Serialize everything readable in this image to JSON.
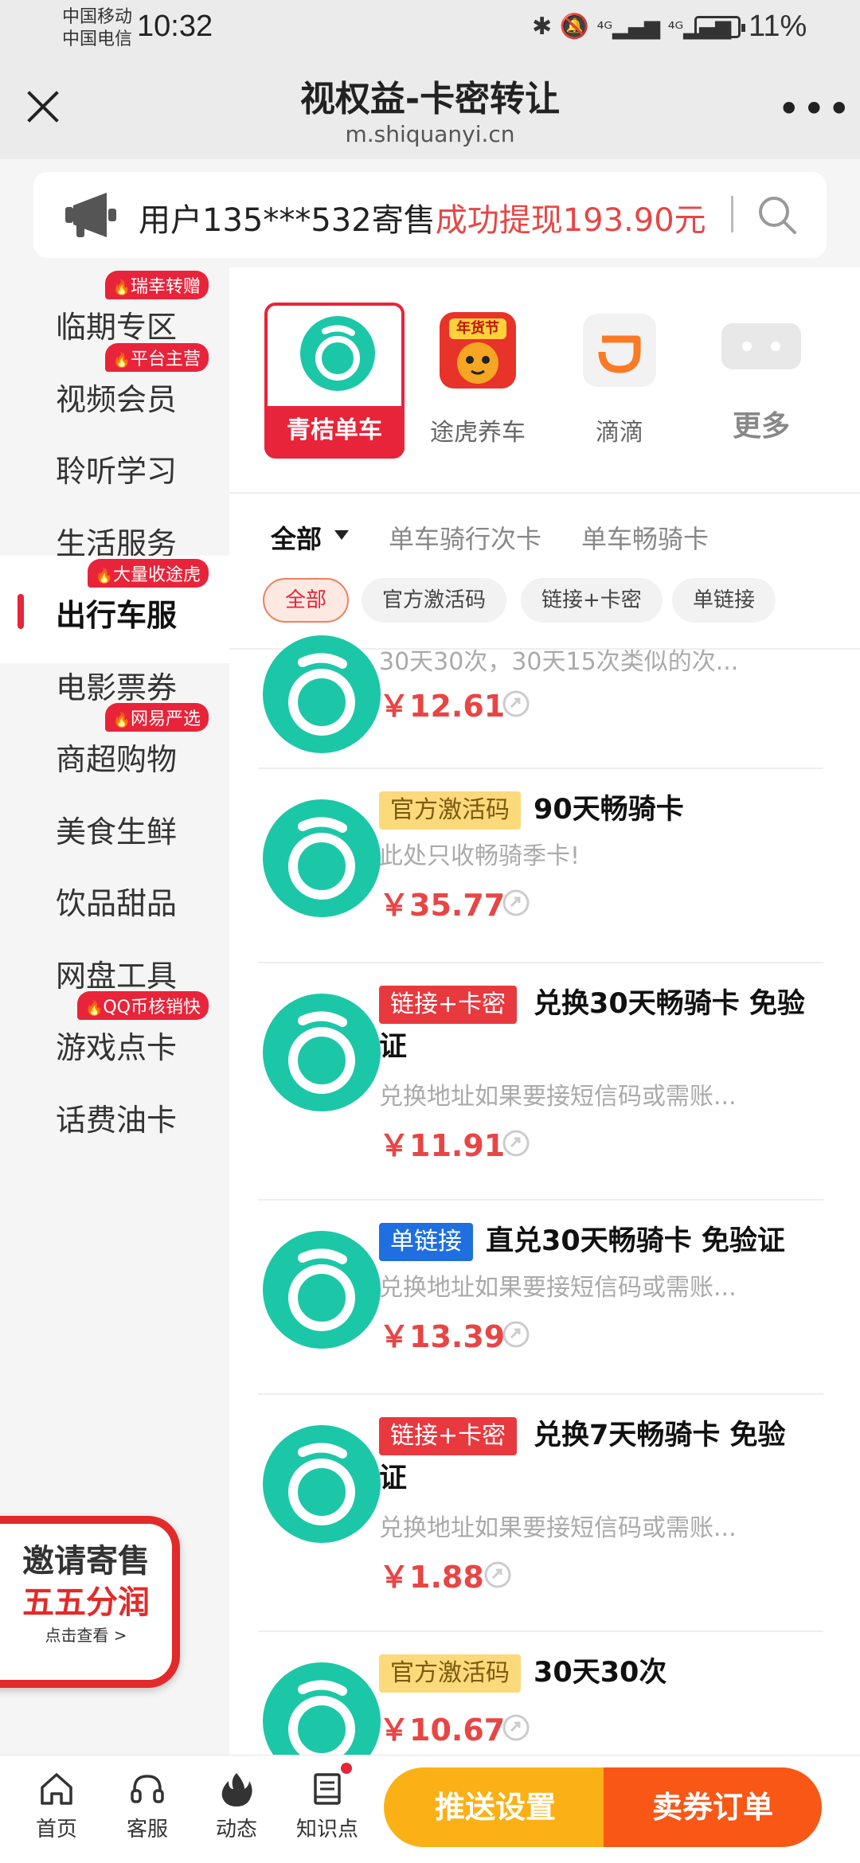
{
  "status_bar": {
    "carrier_1": "中国移动",
    "carrier_2": "中国电信",
    "time": "10:32",
    "signal_1": "⁴ᴳ",
    "signal_2": "⁴ᴳ",
    "battery": "11%"
  },
  "header": {
    "title": "视权益-卡密转让",
    "url": "m.shiquanyi.cn",
    "more_label": "•••"
  },
  "notice": {
    "prefix": "用户135***532寄售",
    "highlight": "成功提现193.90元"
  },
  "sidebar": {
    "items": [
      {
        "label": "临期专区",
        "tag": "瑞幸转赠"
      },
      {
        "label": "视频会员",
        "tag": "平台主营"
      },
      {
        "label": "聆听学习",
        "tag": ""
      },
      {
        "label": "生活服务",
        "tag": ""
      },
      {
        "label": "出行车服",
        "tag": "大量收途虎",
        "active": true
      },
      {
        "label": "电影票券",
        "tag": ""
      },
      {
        "label": "商超购物",
        "tag": "网易严选"
      },
      {
        "label": "美食生鲜",
        "tag": ""
      },
      {
        "label": "饮品甜品",
        "tag": ""
      },
      {
        "label": "网盘工具",
        "tag": ""
      },
      {
        "label": "游戏点卡",
        "tag": "QQ币核销快"
      },
      {
        "label": "话费油卡",
        "tag": ""
      }
    ]
  },
  "invite": {
    "line1": "邀请寄售",
    "line2": "五五分润",
    "line3": "点击查看 >"
  },
  "brands": [
    {
      "name": "青桔单车",
      "active": true
    },
    {
      "name": "途虎养车",
      "badge": "年货节"
    },
    {
      "name": "滴滴"
    },
    {
      "name": "更多"
    }
  ],
  "tabs": [
    {
      "label": "全部",
      "active": true
    },
    {
      "label": "单车骑行次卡"
    },
    {
      "label": "单车畅骑卡"
    }
  ],
  "chips": [
    {
      "label": "全部",
      "active": true
    },
    {
      "label": "官方激活码"
    },
    {
      "label": "链接+卡密"
    },
    {
      "label": "单链接"
    }
  ],
  "products": [
    {
      "tag": "",
      "title": "",
      "desc": "30天30次，30天15次类似的次...",
      "price": "￥12.61"
    },
    {
      "tag": "官方激活码",
      "tag_color": "yellow",
      "title": "90天畅骑卡",
      "desc": "此处只收畅骑季卡!",
      "price": "￥35.77"
    },
    {
      "tag": "链接+卡密",
      "tag_color": "red",
      "title": "兑换30天畅骑卡 免验证",
      "desc": "兑换地址如果要接短信码或需账...",
      "price": "￥11.91"
    },
    {
      "tag": "单链接",
      "tag_color": "blue",
      "title": "直兑30天畅骑卡 免验证",
      "desc": "兑换地址如果要接短信码或需账...",
      "price": "￥13.39"
    },
    {
      "tag": "链接+卡密",
      "tag_color": "red",
      "title": "兑换7天畅骑卡 免验证",
      "desc": "兑换地址如果要接短信码或需账...",
      "price": "￥1.88"
    },
    {
      "tag": "官方激活码",
      "tag_color": "yellow",
      "title": "30天30次",
      "desc": "",
      "price": "￥10.67"
    }
  ],
  "bottom_nav": [
    {
      "label": "首页",
      "icon": "home-icon"
    },
    {
      "label": "客服",
      "icon": "headset-icon"
    },
    {
      "label": "动态",
      "icon": "flame-icon"
    },
    {
      "label": "知识点",
      "icon": "book-icon"
    }
  ],
  "buttons": {
    "push_settings": "推送设置",
    "sell_orders": "卖券订单"
  },
  "colors": {
    "accent_red": "#e8243a",
    "price_red": "#e84545",
    "qingju_green": "#1cc7a8",
    "orange": "#fbb015",
    "deep_orange": "#f85716"
  }
}
